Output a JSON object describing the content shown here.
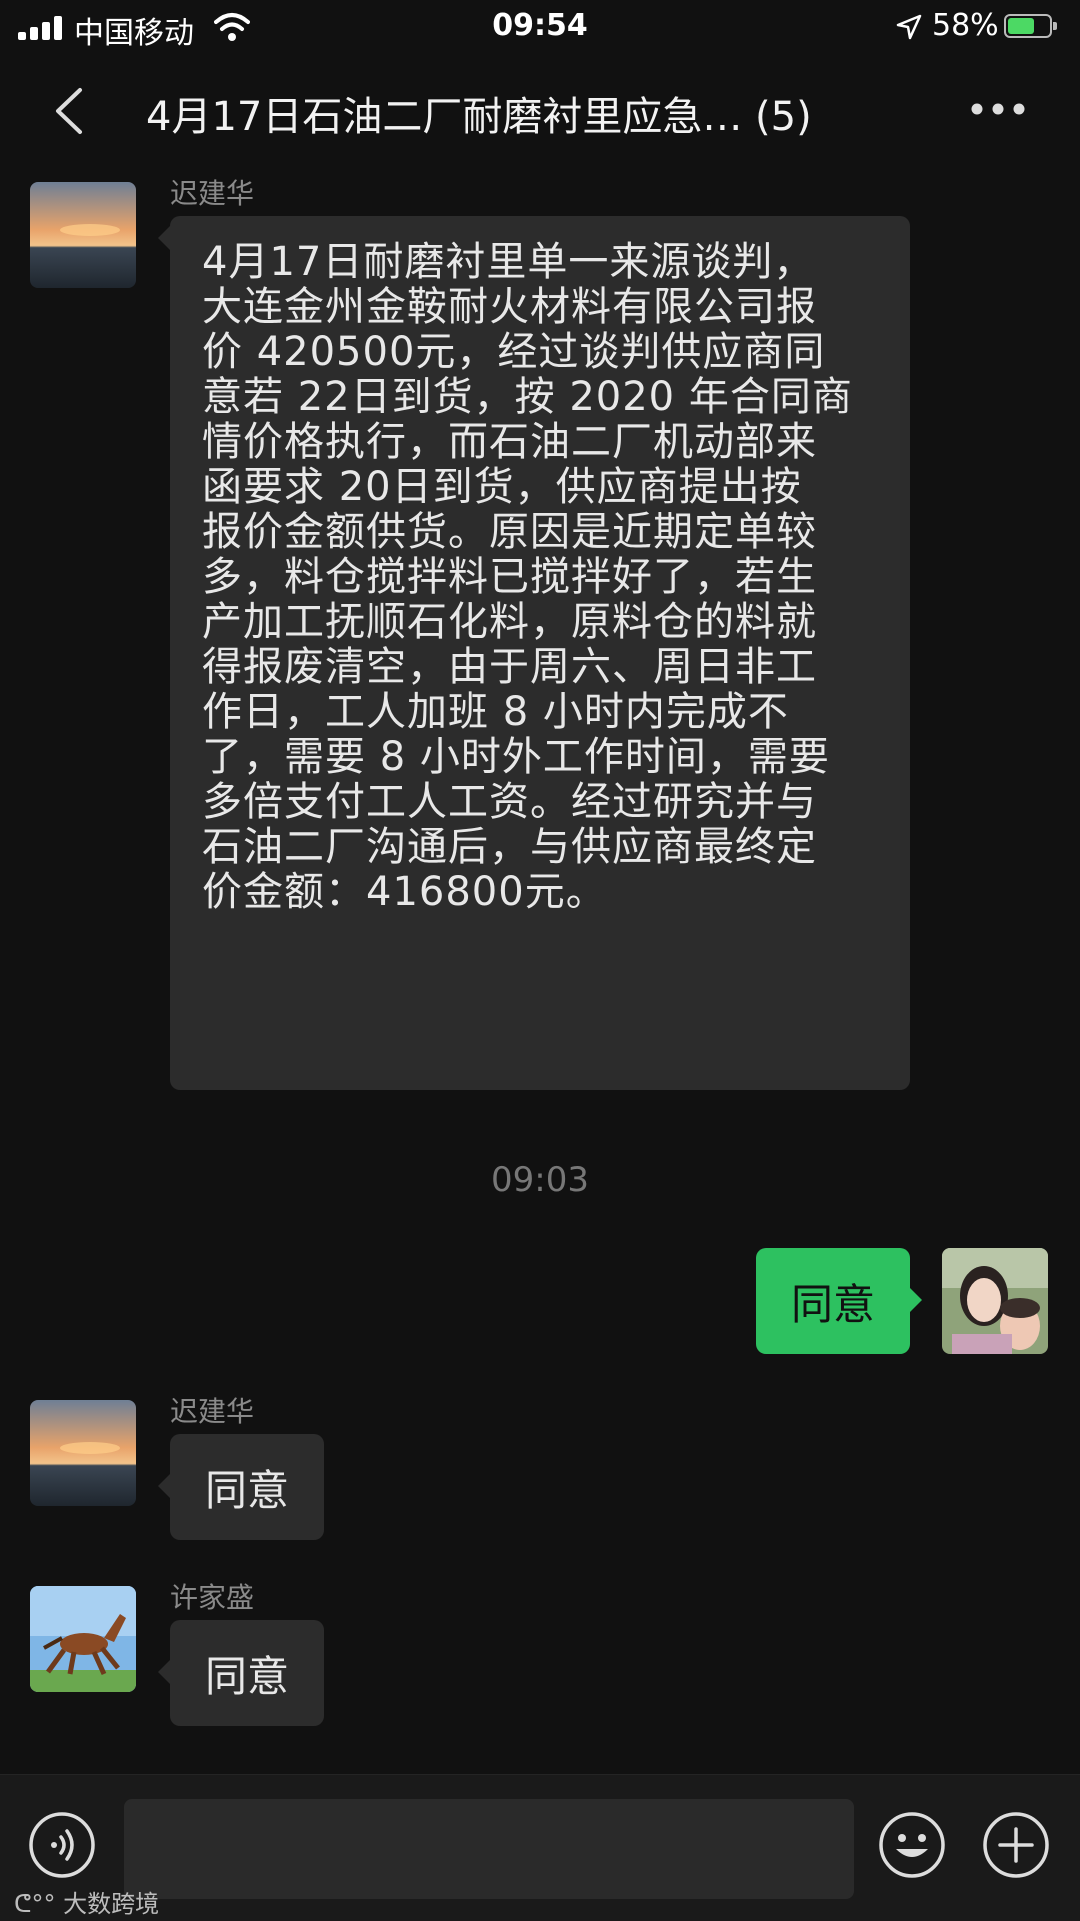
{
  "status_bar": {
    "carrier": "中国移动",
    "time": "09:54",
    "battery": "58%",
    "battery_level": 0.58
  },
  "nav": {
    "title": "4月17日石油二厂耐磨衬里应急…  (5)",
    "back_icon": "chevron-left-icon",
    "more_icon": "more-dots-icon"
  },
  "messages": [
    {
      "sender": "迟建华",
      "text": "4月17日耐磨衬里单一来源谈判，\n大连金州金鞍耐火材料有限公司报\n价 420500元，经过谈判供应商同\n意若 22日到货，按 2020 年合同商\n情价格执行，而石油二厂机动部来\n函要求 20日到货，供应商提出按\n报价金额供货。原因是近期定单较\n多，料仓搅拌料已搅拌好了，若生\n产加工抚顺石化料，原料仓的料就\n得报废清空，由于周六、周日非工\n作日，工人加班 8 小时内完成不\n了，需要 8 小时外工作时间，需要\n多倍支付工人工资。经过研究并与\n石油二厂沟通后，与供应商最终定\n价金额：416800元。"
    },
    {
      "timestamp": "09:03"
    },
    {
      "sender": "self",
      "text": "同意"
    },
    {
      "sender": "迟建华",
      "text": "同意"
    },
    {
      "sender": "许家盛",
      "text": "同意"
    }
  ],
  "input_bar": {
    "voice_icon": "voice-icon",
    "emoji_icon": "emoji-icon",
    "plus_icon": "plus-icon"
  },
  "watermark": "大数跨境",
  "colors": {
    "background": "#111111",
    "bubble_other": "#2c2c2c",
    "bubble_self": "#2dc160"
  }
}
